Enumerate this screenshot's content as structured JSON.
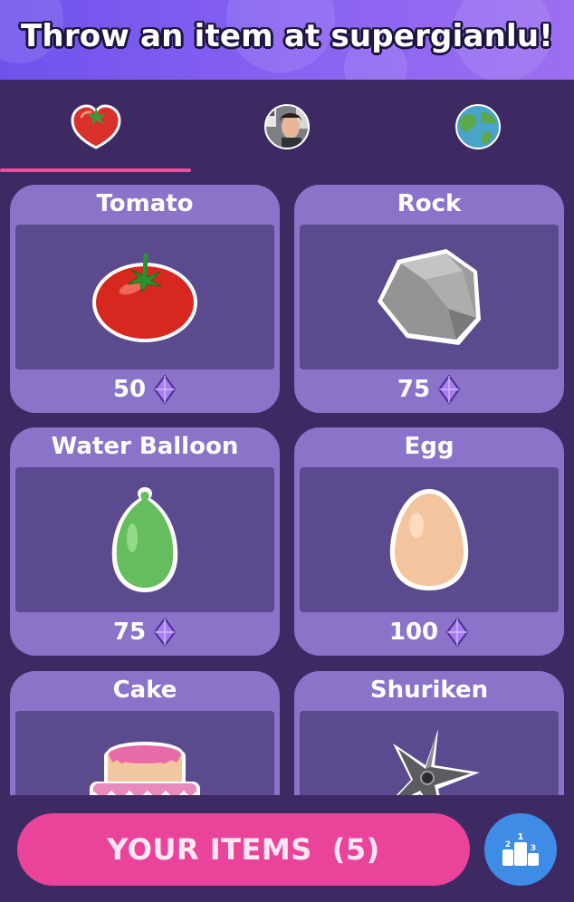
{
  "header": {
    "title": "Throw an item at supergianlu!"
  },
  "tabs": [
    {
      "icon": "tomato-icon",
      "active": true
    },
    {
      "icon": "user-avatar-icon",
      "active": false
    },
    {
      "icon": "globe-icon",
      "active": false
    }
  ],
  "items": [
    {
      "name": "Tomato",
      "price": "50",
      "icon": "tomato-icon"
    },
    {
      "name": "Rock",
      "price": "75",
      "icon": "rock-icon"
    },
    {
      "name": "Water Balloon",
      "price": "75",
      "icon": "water-balloon-icon"
    },
    {
      "name": "Egg",
      "price": "100",
      "icon": "egg-icon"
    },
    {
      "name": "Cake",
      "price": "",
      "icon": "cake-icon"
    },
    {
      "name": "Shuriken",
      "price": "",
      "icon": "shuriken-icon"
    }
  ],
  "currency_icon": "gem-icon",
  "footer": {
    "your_items_label": "YOUR ITEMS",
    "your_items_count": "(5)",
    "leaderboard_icon": "leaderboard-podium-icon"
  },
  "colors": {
    "header_gradient_start": "#6f52ec",
    "header_gradient_end": "#9b6ff0",
    "background": "#3d2a63",
    "card": "#8b73c9",
    "card_well": "#5c4a8f",
    "accent_pink": "#e9449a",
    "accent_blue": "#3f8ce6"
  }
}
